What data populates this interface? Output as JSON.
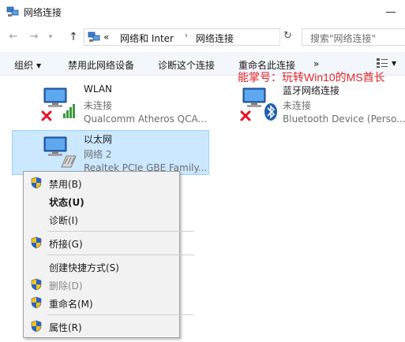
{
  "window": {
    "title": "网络连接"
  },
  "nav": {
    "back": "←",
    "forward": "→",
    "recent": "▾",
    "up": "↑",
    "breadcrumb": [
      "«",
      "网络和 Inter",
      "网络连接"
    ],
    "refresh": "↻",
    "search_placeholder": "搜索\"网络连接\""
  },
  "toolbar": {
    "organize": "组织",
    "disable": "禁用此网络设备",
    "diagnose": "诊断这个连接",
    "rename": "重命名此连接",
    "more": "»"
  },
  "watermark": "能掌号：玩转Win10的MS酋长",
  "connections": [
    {
      "name": "WLAN",
      "status": "未连接",
      "device": "Qualcomm Atheros QCA...",
      "state": "disconnected",
      "type": "wireless",
      "selected": false
    },
    {
      "name": "蓝牙网络连接",
      "status": "未连接",
      "device": "Bluetooth Device (Perso...",
      "state": "disconnected",
      "type": "bluetooth",
      "selected": false
    },
    {
      "name": "以太网",
      "status": "网络 2",
      "device": "Realtek PCIe GBE Family...",
      "state": "connected",
      "type": "ethernet",
      "selected": true
    }
  ],
  "context_menu": [
    {
      "label": "禁用(B)",
      "shield": true,
      "bold": false,
      "disabled": false
    },
    {
      "label": "状态(U)",
      "shield": false,
      "bold": true,
      "disabled": false
    },
    {
      "label": "诊断(I)",
      "shield": false,
      "bold": false,
      "disabled": false
    },
    {
      "label": "桥接(G)",
      "shield": true,
      "bold": false,
      "disabled": false
    },
    {
      "label": "创建快捷方式(S)",
      "shield": false,
      "bold": false,
      "disabled": false
    },
    {
      "label": "删除(D)",
      "shield": true,
      "bold": false,
      "disabled": true
    },
    {
      "label": "重命名(M)",
      "shield": true,
      "bold": false,
      "disabled": false
    },
    {
      "label": "属性(R)",
      "shield": true,
      "bold": false,
      "disabled": false
    }
  ],
  "colors": {
    "selection": "#cce8ff",
    "selection_border": "#99d1ff",
    "toolbar_bg": "#f3f6fb",
    "watermark": "#e0242b",
    "error": "#e81123",
    "signal": "#3a9a3a"
  }
}
